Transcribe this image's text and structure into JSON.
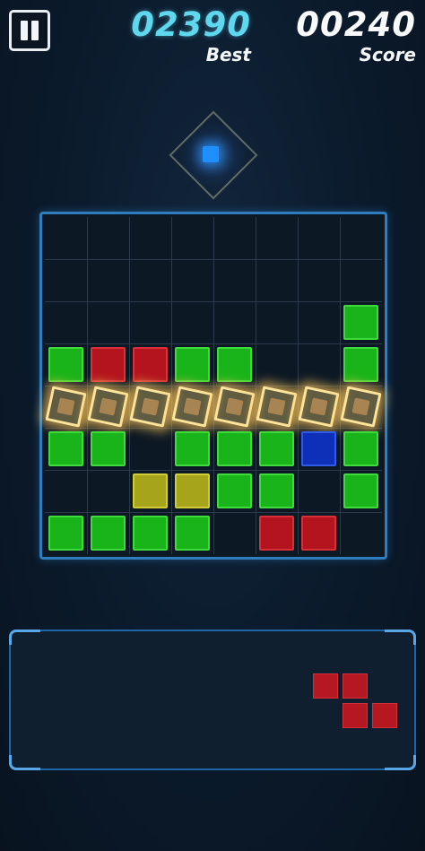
{
  "header": {
    "pause_icon": "pause-icon",
    "best": {
      "value": "02390",
      "label": "Best"
    },
    "score": {
      "value": "00240",
      "label": "Score"
    }
  },
  "colors": {
    "green": "#18b419",
    "red": "#b3141e",
    "yellow": "#a6a41b",
    "blue": "#0e2fb8",
    "board_border": "#2f7dbf",
    "best_text": "#5fd8ee"
  },
  "board": {
    "rows": 8,
    "cols": 8,
    "cells": [
      [
        "",
        "",
        "",
        "",
        "",
        "",
        "",
        ""
      ],
      [
        "",
        "",
        "",
        "",
        "",
        "",
        "",
        ""
      ],
      [
        "",
        "",
        "",
        "",
        "",
        "",
        "",
        "green"
      ],
      [
        "green",
        "red",
        "red",
        "green",
        "green",
        "",
        "",
        "green"
      ],
      [
        "flash",
        "flash",
        "flash",
        "flash",
        "flash",
        "flash",
        "flash",
        "flash"
      ],
      [
        "green",
        "green",
        "",
        "green",
        "green",
        "green",
        "blue",
        "green"
      ],
      [
        "",
        "",
        "yellow",
        "yellow",
        "green",
        "green",
        "",
        "green"
      ],
      [
        "green",
        "green",
        "green",
        "green",
        "",
        "red",
        "red",
        ""
      ]
    ]
  },
  "next_piece": {
    "color": "red",
    "shape": [
      [
        1,
        1,
        0
      ],
      [
        0,
        1,
        1
      ]
    ]
  }
}
